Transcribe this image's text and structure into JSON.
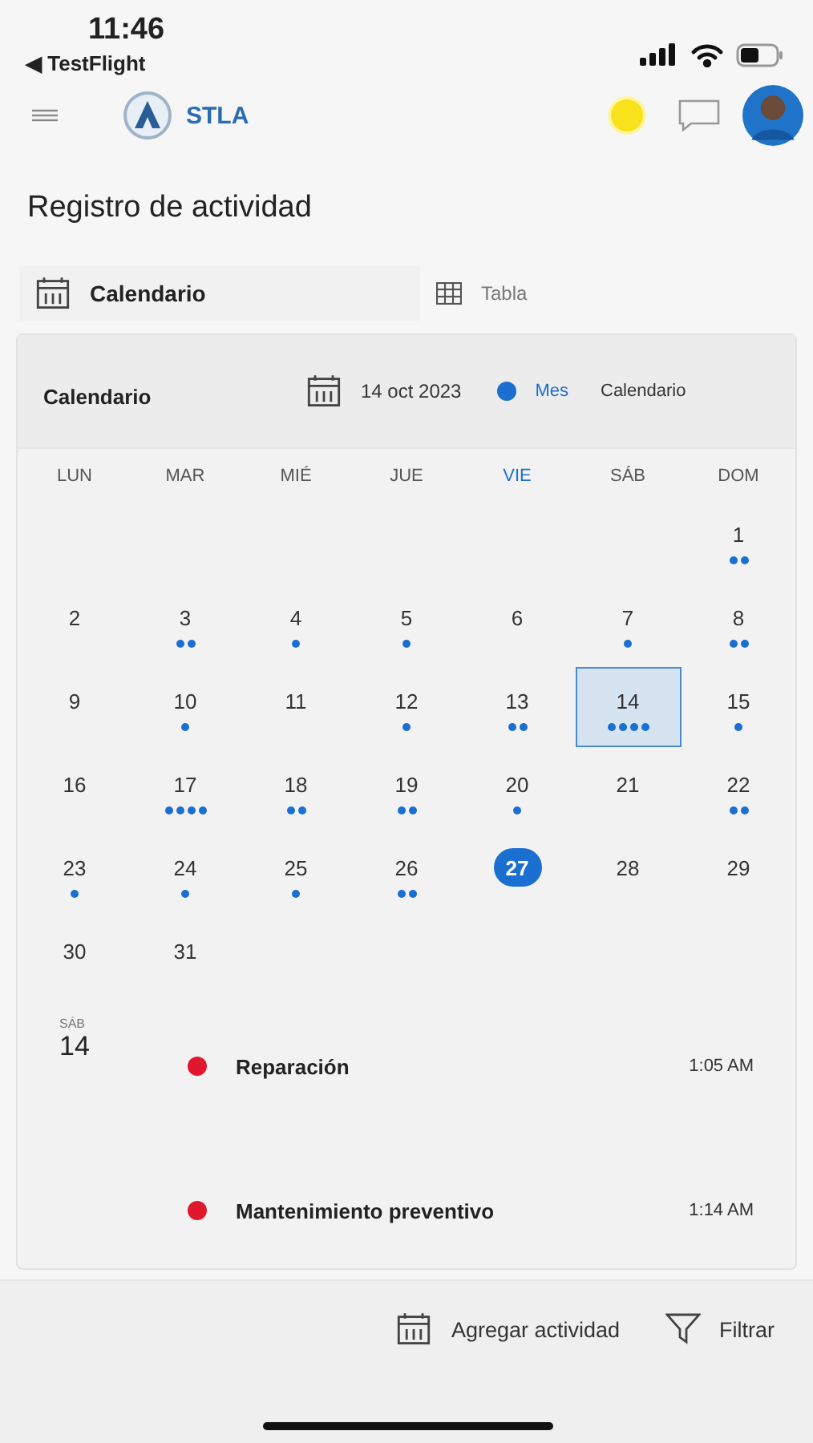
{
  "status_bar": {
    "time": "11:46",
    "back_app": "◀ TestFlight"
  },
  "header": {
    "brand": "STLA"
  },
  "page_title": "Registro de actividad",
  "tabs": [
    {
      "label": "Calendario",
      "selected": true
    },
    {
      "label": "Tabla",
      "selected": false
    }
  ],
  "calendar": {
    "title": "Calendario",
    "date": "14 oct 2023",
    "view_options": [
      {
        "label": "Mes",
        "selected": true
      },
      {
        "label": "Calendario",
        "selected": false
      }
    ],
    "weekdays": [
      {
        "label": "LUN",
        "current": false
      },
      {
        "label": "MAR",
        "current": false
      },
      {
        "label": "MIÉ",
        "current": false
      },
      {
        "label": "JUE",
        "current": false
      },
      {
        "label": "VIE",
        "current": true
      },
      {
        "label": "SÁB",
        "current": false
      },
      {
        "label": "DOM",
        "current": false
      }
    ],
    "weeks": [
      {
        "kind": "first",
        "days": [
          {
            "day": "1",
            "selected": false,
            "today": false,
            "dots": [
              {
                "kind": "event"
              },
              {
                "kind": "event"
              }
            ]
          }
        ]
      },
      {
        "kind": "full",
        "days": [
          {
            "day": "2",
            "selected": false,
            "today": false
          },
          {
            "day": "3",
            "selected": false,
            "today": false,
            "dots": [
              {
                "kind": "event"
              },
              {
                "kind": "event"
              }
            ]
          },
          {
            "day": "4",
            "selected": false,
            "today": false,
            "dots": [
              {
                "kind": "event"
              }
            ]
          },
          {
            "day": "5",
            "selected": false,
            "today": false,
            "dots": [
              {
                "kind": "event"
              }
            ]
          },
          {
            "day": "6",
            "selected": false,
            "today": false
          },
          {
            "day": "7",
            "selected": false,
            "today": false,
            "dots": [
              {
                "kind": "event"
              }
            ]
          },
          {
            "day": "8",
            "selected": false,
            "today": false,
            "dots": [
              {
                "kind": "event"
              },
              {
                "kind": "event"
              }
            ]
          }
        ]
      },
      {
        "kind": "full",
        "days": [
          {
            "day": "9",
            "selected": false,
            "today": false
          },
          {
            "day": "10",
            "selected": false,
            "today": false,
            "dots": [
              {
                "kind": "event"
              }
            ]
          },
          {
            "day": "11",
            "selected": false,
            "today": false
          },
          {
            "day": "12",
            "selected": false,
            "today": false,
            "dots": [
              {
                "kind": "event"
              }
            ]
          },
          {
            "day": "13",
            "selected": false,
            "today": false,
            "dots": [
              {
                "kind": "event"
              },
              {
                "kind": "event"
              }
            ]
          },
          {
            "day": "14",
            "selected": true,
            "today": false,
            "dots": [
              {
                "kind": "event"
              },
              {
                "kind": "event"
              },
              {
                "kind": "event"
              },
              {
                "kind": "event"
              }
            ]
          },
          {
            "day": "15",
            "selected": false,
            "today": false,
            "dots": [
              {
                "kind": "event"
              }
            ]
          }
        ]
      },
      {
        "kind": "full",
        "days": [
          {
            "day": "16",
            "selected": false,
            "today": false
          },
          {
            "day": "17",
            "selected": false,
            "today": false,
            "dots": [
              {
                "kind": "event"
              },
              {
                "kind": "event"
              },
              {
                "kind": "event"
              },
              {
                "kind": "event"
              }
            ]
          },
          {
            "day": "18",
            "selected": false,
            "today": false,
            "dots": [
              {
                "kind": "event"
              },
              {
                "kind": "event"
              }
            ]
          },
          {
            "day": "19",
            "selected": false,
            "today": false,
            "dots": [
              {
                "kind": "event"
              },
              {
                "kind": "event"
              }
            ]
          },
          {
            "day": "20",
            "selected": false,
            "today": false,
            "dots": [
              {
                "kind": "event"
              }
            ]
          },
          {
            "day": "21",
            "selected": false,
            "today": false
          },
          {
            "day": "22",
            "selected": false,
            "today": false,
            "dots": [
              {
                "kind": "event"
              },
              {
                "kind": "event"
              }
            ]
          }
        ]
      },
      {
        "kind": "full",
        "days": [
          {
            "day": "23",
            "selected": false,
            "today": false,
            "dots": [
              {
                "kind": "event"
              }
            ]
          },
          {
            "day": "24",
            "selected": false,
            "today": false,
            "dots": [
              {
                "kind": "event"
              }
            ]
          },
          {
            "day": "25",
            "selected": false,
            "today": false,
            "dots": [
              {
                "kind": "event"
              }
            ]
          },
          {
            "day": "26",
            "selected": false,
            "today": false,
            "dots": [
              {
                "kind": "event"
              },
              {
                "kind": "event"
              }
            ]
          },
          {
            "day": "27",
            "selected": false,
            "today": true
          },
          {
            "day": "28",
            "selected": false,
            "today": false
          },
          {
            "day": "29",
            "selected": false,
            "today": false
          }
        ]
      },
      {
        "kind": "last",
        "days": [
          {
            "day": "30",
            "selected": false,
            "today": false
          },
          {
            "day": "31",
            "selected": false,
            "today": false
          }
        ]
      }
    ],
    "agenda": {
      "weekday": "SÁB",
      "day": "14",
      "events": [
        {
          "name": "Reparación",
          "time": "1:05 AM",
          "color": "#e0182d"
        },
        {
          "name": "Mantenimiento preventivo",
          "time": "1:14 AM",
          "color": "#e0182d"
        }
      ]
    }
  },
  "actions": [
    {
      "kind": "add",
      "label": "Agregar actividad"
    },
    {
      "kind": "filter",
      "label": "Filtrar"
    }
  ]
}
